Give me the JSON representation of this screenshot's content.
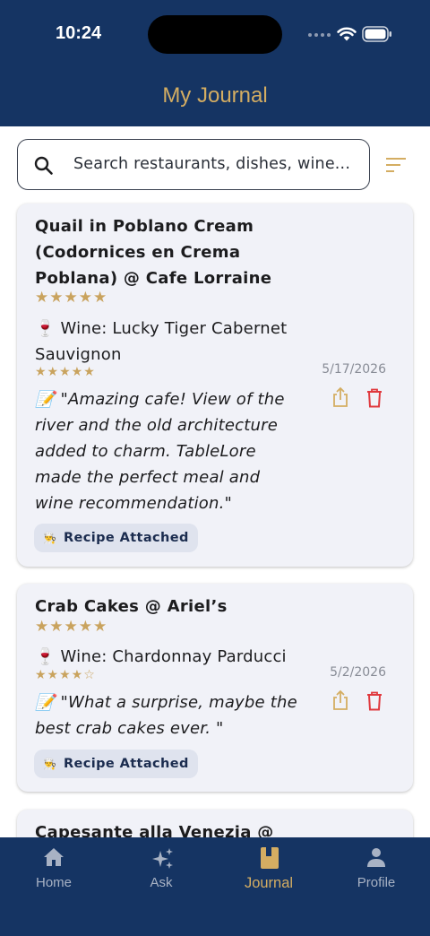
{
  "status_bar": {
    "time": "10:24"
  },
  "header": {
    "title": "My Journal"
  },
  "search": {
    "placeholder": "Search restaurants, dishes, wine..."
  },
  "entries": [
    {
      "title_lines": [
        "Quail in Poblano Cream",
        "(Codornices en Crema",
        "Poblana) @ Cafe Lorraine"
      ],
      "dish_stars": "★★★★★",
      "dish_rating": 5,
      "wine_line1": "🍷 Wine: Lucky Tiger Cabernet",
      "wine_line2": "Sauvignon",
      "wine_stars": "★★★★★",
      "wine_rating": 5,
      "note_lines": [
        "📝 \"Amazing cafe! View of the",
        "river and the old architecture",
        "added to charm. TableLore",
        "made the perfect meal and",
        "wine recommendation.\""
      ],
      "date": "5/17/2026",
      "badge_icon": "👨‍🍳",
      "badge": "Recipe Attached"
    },
    {
      "title_lines": [
        "Crab Cakes @ Ariel’s"
      ],
      "dish_stars": "★★★★★",
      "dish_rating": 5,
      "wine_line1": "🍷 Wine: Chardonnay Parducci",
      "wine_stars": "★★★★☆",
      "wine_rating": 4,
      "note_lines": [
        "📝 \"What a surprise, maybe the",
        "best crab cakes ever. \""
      ],
      "date": "5/2/2026",
      "badge_icon": "👨‍🍳",
      "badge": "Recipe Attached"
    },
    {
      "title_lines": [
        "Capesante alla Venezia @"
      ]
    }
  ],
  "nav": {
    "home": "Home",
    "ask": "Ask",
    "journal": "Journal",
    "profile": "Profile",
    "active": "journal"
  },
  "colors": {
    "primary": "#153463",
    "accent_gold": "#d4ad62",
    "card_bg": "#f1f2f8",
    "delete_red": "#e0393e"
  }
}
